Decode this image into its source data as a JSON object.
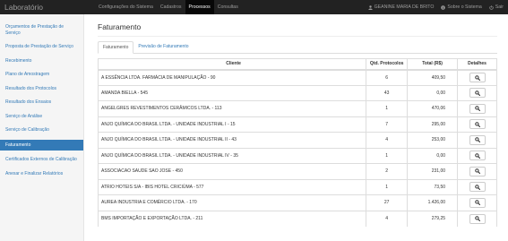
{
  "navbar": {
    "brand": "Laboratório",
    "items": [
      "Configurações do Sistema",
      "Cadastros",
      "Processos",
      "Consultas"
    ],
    "active_index": 2,
    "user": "GEANINE MARIA DE BRITO",
    "about": "Sobre o Sistema",
    "logout": "Sair"
  },
  "sidebar": {
    "items": [
      "Orçamentos de Prestação de Serviço",
      "Proposta de Prestação de Serviço",
      "Recebimento",
      "Plano de Amostragem",
      "Resultado dos Protocolos",
      "Resultado dos Ensaios",
      "Serviço de Análise",
      "Serviço de Calibração",
      "Faturamento",
      "Certificados Externos de Calibração",
      "Anexar e Finalizar Relatórios"
    ],
    "active_index": 8
  },
  "main": {
    "title": "Faturamento",
    "tabs": [
      "Faturamento",
      "Previsão de Faturamento"
    ],
    "table": {
      "headers": [
        "Cliente",
        "Qtd. Protocolos",
        "Total (R$)",
        "Detalhes"
      ],
      "rows": [
        {
          "cliente": "A ESSÊNCIA LTDA. FARMÁCIA DE MANIPULAÇÃO - 90",
          "qtd": "6",
          "total": "409,50"
        },
        {
          "cliente": "AMANDA BIELLA - 545",
          "qtd": "43",
          "total": "0,00"
        },
        {
          "cliente": "ANGELGRES REVESTIMENTOS CERÂMICOS LTDA. - 113",
          "qtd": "1",
          "total": "470,06"
        },
        {
          "cliente": "ANJO QUÍMICA DO BRASIL LTDA. - UNIDADE INDUSTRIAL I - 15",
          "qtd": "7",
          "total": "295,00"
        },
        {
          "cliente": "ANJO QUÍMICA DO BRASIL LTDA. - UNIDADE INDUSTRIAL II - 43",
          "qtd": "4",
          "total": "253,00"
        },
        {
          "cliente": "ANJO QUÍMICA DO BRASIL LTDA. - UNIDADE INDUSTRIAL IV - 35",
          "qtd": "1",
          "total": "0,00"
        },
        {
          "cliente": "ASSOCIACAO SAUDE SAO JOSE - 450",
          "qtd": "2",
          "total": "231,00"
        },
        {
          "cliente": "ATRIO HOTEIS S/A - IBIS HOTEL CRICIÚMA - 577",
          "qtd": "1",
          "total": "73,50"
        },
        {
          "cliente": "AUREA INDUSTRIA E COMÉRCIO LTDA. - 170",
          "qtd": "27",
          "total": "1.426,00"
        },
        {
          "cliente": "BMS IMPORTAÇÃO E EXPORTAÇÃO LTDA. - 211",
          "qtd": "4",
          "total": "279,25"
        }
      ]
    }
  },
  "icons": {
    "user": "user-icon",
    "about": "info-icon",
    "logout": "power-icon",
    "details": "search-icon"
  },
  "colors": {
    "navbar_bg": "#222222",
    "link": "#337ab7",
    "active_bg": "#337ab7"
  }
}
